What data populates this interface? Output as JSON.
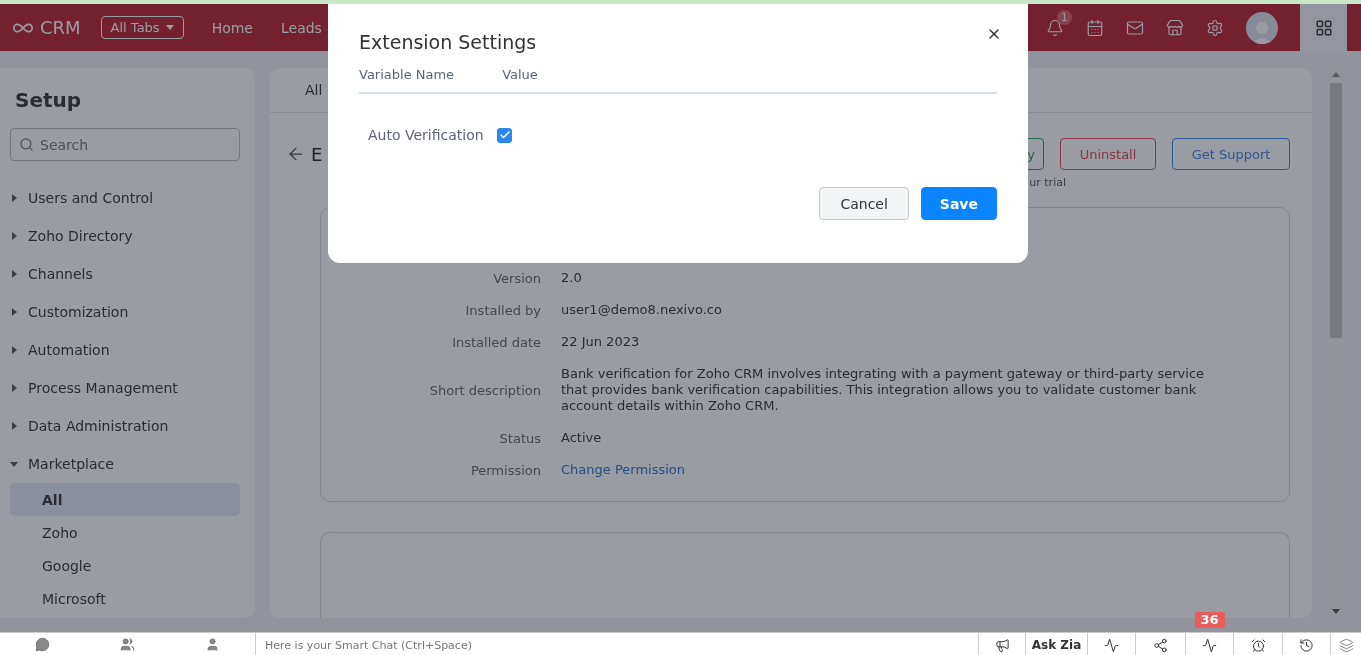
{
  "header": {
    "logo": "CRM",
    "all_tabs": "All Tabs",
    "nav": [
      "Home",
      "Leads"
    ],
    "notification_count": "1"
  },
  "sidebar": {
    "title": "Setup",
    "search_placeholder": "Search",
    "items": [
      {
        "label": "Users and Control",
        "expanded": false
      },
      {
        "label": "Zoho Directory",
        "expanded": false
      },
      {
        "label": "Channels",
        "expanded": false
      },
      {
        "label": "Customization",
        "expanded": false
      },
      {
        "label": "Automation",
        "expanded": false
      },
      {
        "label": "Process Management",
        "expanded": false
      },
      {
        "label": "Data Administration",
        "expanded": false
      },
      {
        "label": "Marketplace",
        "expanded": true,
        "children": [
          {
            "label": "All",
            "selected": true
          },
          {
            "label": "Zoho",
            "selected": false
          },
          {
            "label": "Google",
            "selected": false
          },
          {
            "label": "Microsoft",
            "selected": false
          }
        ]
      }
    ]
  },
  "content": {
    "tab": "All",
    "heading": "E",
    "buttons": [
      {
        "label": "y",
        "kind": "success"
      },
      {
        "label": "Uninstall",
        "kind": "danger"
      },
      {
        "label": "Get Support",
        "kind": "primary"
      }
    ],
    "note": "ur trial",
    "details": [
      {
        "label": "Version",
        "value": "2.0",
        "kind": "text"
      },
      {
        "label": "Installed by",
        "value": "user1@demo8.nexivo.co",
        "kind": "text"
      },
      {
        "label": "Installed date",
        "value": "22 Jun 2023",
        "kind": "text"
      },
      {
        "label": "Short description",
        "value": "Bank verification for Zoho CRM involves integrating with a payment gateway or third-party service that provides bank verification capabilities. This integration allows you to validate customer bank account details within Zoho CRM.",
        "kind": "text"
      },
      {
        "label": "Status",
        "value": "Active",
        "kind": "text"
      },
      {
        "label": "Permission",
        "value": "Change Permission",
        "kind": "link"
      }
    ]
  },
  "dialog": {
    "title": "Extension Settings",
    "columns": [
      "Variable Name",
      "Value"
    ],
    "rows": [
      {
        "name": "Auto Verification",
        "checked": true
      }
    ],
    "buttons": [
      {
        "label": "Cancel",
        "kind": "secondary"
      },
      {
        "label": "Save",
        "kind": "primary"
      }
    ]
  },
  "bottom_bar": {
    "placeholder": "Here is your Smart Chat (Ctrl+Space)",
    "ask_zia": "Ask Zia",
    "badge": "36"
  }
}
